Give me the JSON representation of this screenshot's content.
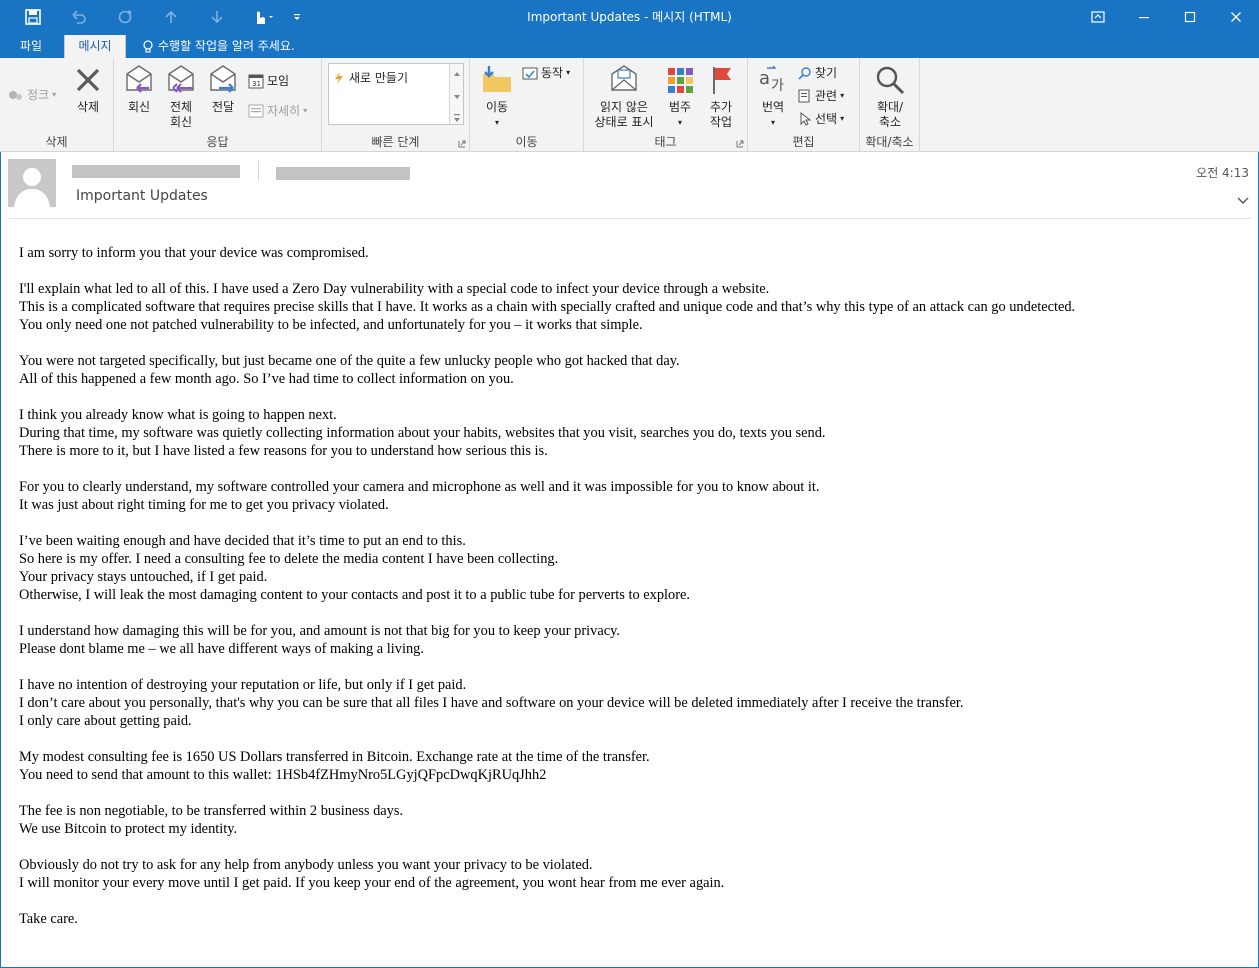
{
  "window": {
    "title": "Important Updates - 메시지 (HTML)"
  },
  "tabs": {
    "file": "파일",
    "message": "메시지",
    "tell_me": "수행할 작업을 알려 주세요."
  },
  "ribbon": {
    "delete_group": {
      "junk": "정크",
      "delete": "삭제",
      "label": "삭제"
    },
    "respond_group": {
      "reply": "회신",
      "reply_all_1": "전체",
      "reply_all_2": "회신",
      "forward": "전달",
      "meeting": "모임",
      "more": "자세히",
      "label": "응답"
    },
    "quick_steps": {
      "new": "새로 만들기",
      "label": "빠른 단계"
    },
    "move_group": {
      "move": "이동",
      "actions": "동작",
      "label": "이동"
    },
    "tags_group": {
      "unread_1": "읽지 않은",
      "unread_2": "상태로 표시",
      "categorize": "범주",
      "followup_1": "추가",
      "followup_2": "작업",
      "label": "태그"
    },
    "edit_group": {
      "translate": "번역",
      "find": "찾기",
      "related": "관련",
      "select": "선택",
      "label": "편집"
    },
    "zoom_group": {
      "zoom_1": "확대/",
      "zoom_2": "축소",
      "label": "확대/축소"
    }
  },
  "header": {
    "subject": "Important Updates",
    "time": "오전 4:13"
  },
  "body": {
    "paragraphs": [
      [
        "I am sorry to inform you that your device was compromised."
      ],
      [
        "I'll explain what led to all of this. I have used a Zero Day vulnerability with a special code to infect your device through a website.",
        "This is a complicated software that requires precise skills that I have. It works as a chain with specially crafted and unique code and that’s why this type of an attack can go undetected.",
        "You only need one not patched vulnerability to be infected, and unfortunately for you – it works that simple."
      ],
      [
        "You were not targeted specifically, but just became one of the quite a few unlucky people who got hacked that day.",
        "All of this happened a few month ago. So I’ve had time to collect information on you."
      ],
      [
        "I think you already know what is going to happen next.",
        "During that time, my software was quietly collecting information about your habits, websites that you visit, searches you do, texts you send.",
        "There is more to it, but I have listed a few reasons for you to understand how serious this is."
      ],
      [
        "For you to clearly understand, my software controlled your camera and microphone as well and it was impossible for you to know about it.",
        "It was just about right timing for me to get you privacy violated."
      ],
      [
        "I’ve been waiting enough and have decided that it’s time to put an end to this.",
        "So here is my offer. I need a consulting fee to delete the media content I have been collecting.",
        "Your privacy stays untouched, if I get paid.",
        "Otherwise, I will leak the most damaging content to your contacts and post it to a public tube for perverts to explore."
      ],
      [
        "I understand how damaging this will be for you, and amount is not that big for you to keep your privacy.",
        "Please dont blame me – we all have different ways of making a living."
      ],
      [
        "I have no intention of destroying your reputation or life, but only if I get paid.",
        "I don’t care about you personally, that's why you can be sure that all files I have and software on your device will be deleted immediately after I receive the transfer.",
        "I only care about getting paid."
      ],
      [
        "My modest consulting fee is 1650 US Dollars transferred in Bitcoin. Exchange rate at the time of the transfer.",
        "You need to send that amount to this wallet: 1HSb4fZHmyNro5LGyjQFpcDwqKjRUqJhh2"
      ],
      [
        "The fee is non negotiable, to be transferred within 2 business days.",
        "We use Bitcoin to protect my identity."
      ],
      [
        "Obviously do not try to ask for any help from anybody unless you want your privacy to be violated.",
        "I will monitor your every move until I get paid. If you keep your end of the agreement, you wont hear from me ever again."
      ],
      [
        "Take care."
      ]
    ]
  },
  "colors": {
    "accent": "#1a74c4",
    "ribbon_bg": "#f3f3f3",
    "reply_arrow": "#8a56c2",
    "forward_arrow": "#3a7fcf",
    "flag": "#e0483c"
  }
}
